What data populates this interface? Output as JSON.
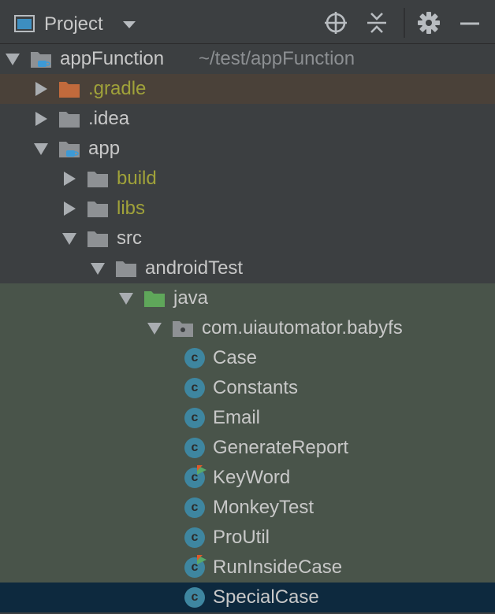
{
  "toolbar": {
    "title": "Project",
    "view_icon": "project-view-icon",
    "dropdown_icon": "chevron-down-icon",
    "buttons": [
      {
        "name": "locate-button",
        "icon": "crosshair-icon"
      },
      {
        "name": "collapse-all-button",
        "icon": "collapse-all-icon"
      },
      {
        "name": "settings-button",
        "icon": "gear-icon"
      },
      {
        "name": "hide-button",
        "icon": "minimize-icon"
      }
    ]
  },
  "colors": {
    "panel_bg": "#3c3f41",
    "excluded_row_bg": "#4a4139",
    "test_source_bg": "#49544a",
    "selected_row_bg": "#0d293e",
    "excluded_text": "#a0a23a",
    "default_text": "#c8c8c8",
    "class_icon": "#3e86a0",
    "gradle_folder": "#c16a3c",
    "test_folder": "#5fa75a",
    "folder": "#8e9194"
  },
  "tree": {
    "items": [
      {
        "label": "appFunction",
        "hint": "~/test/appFunction",
        "depth": 0,
        "expanded": true,
        "kind": "module",
        "style": "normal"
      },
      {
        "label": ".gradle",
        "depth": 1,
        "expanded": false,
        "kind": "folder-orange",
        "style": "excluded-highlight"
      },
      {
        "label": ".idea",
        "depth": 1,
        "expanded": false,
        "kind": "folder",
        "style": "normal"
      },
      {
        "label": "app",
        "depth": 1,
        "expanded": true,
        "kind": "module",
        "style": "normal"
      },
      {
        "label": "build",
        "depth": 2,
        "expanded": false,
        "kind": "folder",
        "style": "excluded"
      },
      {
        "label": "libs",
        "depth": 2,
        "expanded": false,
        "kind": "folder",
        "style": "excluded"
      },
      {
        "label": "src",
        "depth": 2,
        "expanded": true,
        "kind": "folder",
        "style": "normal"
      },
      {
        "label": "androidTest",
        "depth": 3,
        "expanded": true,
        "kind": "folder",
        "style": "normal"
      },
      {
        "label": "java",
        "depth": 4,
        "expanded": true,
        "kind": "folder-green",
        "style": "test"
      },
      {
        "label": "com.uiautomator.babyfs",
        "depth": 5,
        "expanded": true,
        "kind": "package",
        "style": "test"
      },
      {
        "label": "Case",
        "depth": 6,
        "kind": "class",
        "style": "test"
      },
      {
        "label": "Constants",
        "depth": 6,
        "kind": "class",
        "style": "test"
      },
      {
        "label": "Email",
        "depth": 6,
        "kind": "class",
        "style": "test"
      },
      {
        "label": "GenerateReport",
        "depth": 6,
        "kind": "class",
        "style": "test"
      },
      {
        "label": "KeyWord",
        "depth": 6,
        "kind": "class-runnable",
        "style": "test"
      },
      {
        "label": "MonkeyTest",
        "depth": 6,
        "kind": "class",
        "style": "test"
      },
      {
        "label": "ProUtil",
        "depth": 6,
        "kind": "class",
        "style": "test"
      },
      {
        "label": "RunInsideCase",
        "depth": 6,
        "kind": "class-runnable",
        "style": "test"
      },
      {
        "label": "SpecialCase",
        "depth": 6,
        "kind": "class",
        "style": "selected"
      }
    ]
  }
}
